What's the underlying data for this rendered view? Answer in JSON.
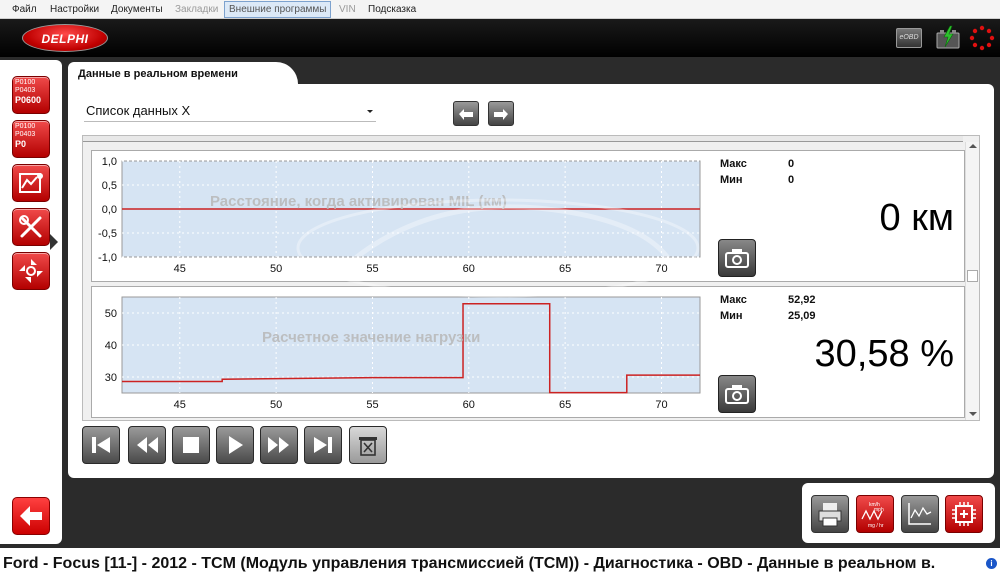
{
  "menu": [
    {
      "label": "Файл",
      "state": "normal"
    },
    {
      "label": "Настройки",
      "state": "normal"
    },
    {
      "label": "Документы",
      "state": "normal"
    },
    {
      "label": "Закладки",
      "state": "disabled"
    },
    {
      "label": "Внешние программы",
      "state": "active"
    },
    {
      "label": "VIN",
      "state": "disabled"
    },
    {
      "label": "Подсказка",
      "state": "normal"
    }
  ],
  "header": {
    "logo_text": "DELPHI",
    "obd_label": "eOBD",
    "icons": [
      "delphi-logo",
      "eobd-icon",
      "battery-icon",
      "status-indicator-icon"
    ]
  },
  "sidebar": {
    "dtc1": [
      "P0100",
      "P0403",
      "P0600"
    ],
    "dtc2": [
      "P0100",
      "P0403",
      "P0"
    ],
    "buttons": [
      "dtc-read-icon",
      "dtc-clear-icon",
      "live-data-icon",
      "service-tools-icon",
      "adjustments-icon",
      "back-arrow-icon"
    ]
  },
  "main": {
    "tab_title": "Данные в реальном времени",
    "select_value": "Список данных X",
    "nav_icons": [
      "undo-arrow-icon",
      "redo-arrow-icon"
    ]
  },
  "charts": [
    {
      "title": "Расстояние, когда активирован MIL (км)",
      "max_label": "Макс",
      "max_value": "0",
      "min_label": "Мин",
      "min_value": "0",
      "current_value": "0 км",
      "y_ticks": [
        "1,0",
        "0,5",
        "0,0",
        "-0,5",
        "-1,0"
      ],
      "x_ticks": [
        "45",
        "50",
        "55",
        "60",
        "65",
        "70"
      ]
    },
    {
      "title": "Расчетное значение нагрузки",
      "max_label": "Макс",
      "max_value": "52,92",
      "min_label": "Мин",
      "min_value": "25,09",
      "current_value": "30,58 %",
      "y_ticks": [
        "50",
        "40",
        "30"
      ],
      "x_ticks": [
        "45",
        "50",
        "55",
        "60",
        "65",
        "70"
      ]
    }
  ],
  "chart_data": [
    {
      "type": "line",
      "title": "Расстояние, когда активирован MIL (км)",
      "xlabel": "",
      "ylabel": "",
      "xlim": [
        42,
        72
      ],
      "ylim": [
        -1.0,
        1.0
      ],
      "x": [
        42,
        72
      ],
      "series": [
        {
          "values": [
            0,
            0
          ]
        }
      ],
      "grid": true,
      "line_color": "#cc2222"
    },
    {
      "type": "line",
      "title": "Расчетное значение нагрузки",
      "xlabel": "",
      "ylabel": "",
      "xlim": [
        42,
        72
      ],
      "ylim": [
        25,
        55
      ],
      "x": [
        42,
        45,
        47.2,
        47.2,
        55,
        59.7,
        59.7,
        64.2,
        64.2,
        68.2,
        68.2,
        72
      ],
      "series": [
        {
          "values": [
            28.6,
            28.6,
            28.6,
            29.3,
            29.8,
            29.8,
            52.9,
            52.9,
            25.1,
            25.1,
            30.6,
            30.6
          ]
        }
      ],
      "grid": true,
      "line_color": "#cc2222"
    }
  ],
  "playback": {
    "icons": [
      "skip-to-start-icon",
      "rewind-icon",
      "stop-icon",
      "play-icon",
      "fast-forward-icon",
      "skip-to-end-icon",
      "delete-recording-icon"
    ]
  },
  "tools": {
    "icons": [
      "print-icon",
      "units-conversion-icon",
      "graph-view-icon",
      "ecu-info-icon"
    ],
    "units_text": [
      "km/h",
      "mph",
      "mg / hr"
    ]
  },
  "status": {
    "text": "Ford - Focus [11-] - 2012 - TCM (Модуль управления трансмиссией (TCM)) - Диагностика - OBD - Данные в реальном в.",
    "info_icon": "i"
  },
  "colors": {
    "chart_bg": "#d6e4f3",
    "series": "#cc2222",
    "brand_red": "#cc0000"
  }
}
